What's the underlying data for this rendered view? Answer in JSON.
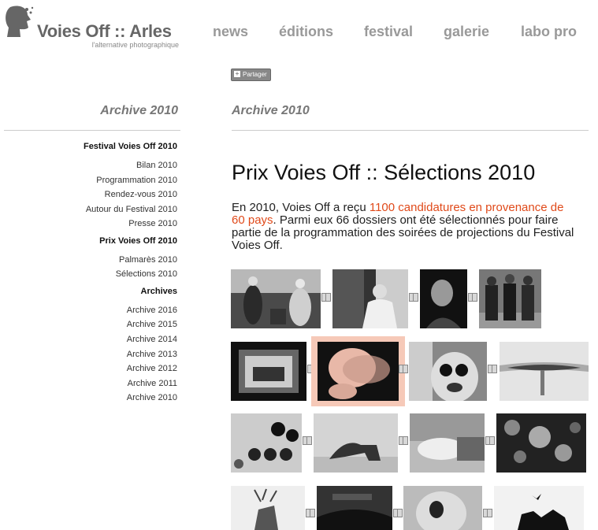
{
  "logo": {
    "title": "Voies Off :: Arles",
    "subtitle": "l'alternative photographique",
    "icon": "head-silhouette-icon"
  },
  "nav": {
    "items": [
      "news",
      "éditions",
      "festival",
      "galerie",
      "labo pro"
    ]
  },
  "share": {
    "label": "Partager",
    "icon": "plus-icon"
  },
  "sidebar": {
    "title": "Archive 2010",
    "items": [
      {
        "label": "Festival Voies Off 2010",
        "head": true
      },
      {
        "label": "Bilan 2010",
        "head": false
      },
      {
        "label": "Programmation 2010",
        "head": false
      },
      {
        "label": "Rendez-vous 2010",
        "head": false
      },
      {
        "label": "Autour du Festival 2010",
        "head": false
      },
      {
        "label": "Presse 2010",
        "head": false
      },
      {
        "label": "Prix Voies Off 2010",
        "head": true
      },
      {
        "label": "Palmarès 2010",
        "head": false
      },
      {
        "label": "Sélections 2010",
        "head": false
      },
      {
        "label": "Archives",
        "head": true
      },
      {
        "label": "Archive 2016",
        "head": false
      },
      {
        "label": "Archive 2015",
        "head": false
      },
      {
        "label": "Archive 2014",
        "head": false
      },
      {
        "label": "Archive 2013",
        "head": false
      },
      {
        "label": "Archive 2012",
        "head": false
      },
      {
        "label": "Archive 2011",
        "head": false
      },
      {
        "label": "Archive 2010",
        "head": false
      }
    ]
  },
  "main": {
    "section_title": "Archive 2010",
    "title": "Prix Voies Off :: Sélections 2010",
    "intro": {
      "line1_a": "En 2010, Voies Off a reçu ",
      "line1_hl": "1100 candidatures en provenance de",
      "line2_hl": "60 pays",
      "line2_b": ". Parmi eux 66 dossiers ont été sélectionnés pour faire",
      "line3": "partie de la programmation des soirées de projections du Festival",
      "line4": "Voies Off."
    }
  },
  "colors": {
    "accent": "#e04a1a",
    "nav": "#999999",
    "highlight_frame": "#f6c9b8"
  },
  "gallery": {
    "thumbs": [
      {
        "name": "thumb-family-portrait",
        "kind": "photo"
      },
      {
        "name": "thumb-man-white-shirt",
        "kind": "photo"
      },
      {
        "name": "thumb-dark-portrait",
        "kind": "photo"
      },
      {
        "name": "thumb-masked-figures",
        "kind": "photo"
      },
      {
        "name": "thumb-framed-car",
        "kind": "photo"
      },
      {
        "name": "thumb-blurred-face",
        "kind": "photo",
        "selected": true
      },
      {
        "name": "thumb-sunglasses-face",
        "kind": "photo"
      },
      {
        "name": "thumb-lips",
        "kind": "photo"
      },
      {
        "name": "thumb-dots",
        "kind": "photo"
      },
      {
        "name": "thumb-figure-floor",
        "kind": "photo"
      },
      {
        "name": "thumb-reclining-body",
        "kind": "photo"
      },
      {
        "name": "thumb-cells",
        "kind": "photo"
      },
      {
        "name": "thumb-deer-statue",
        "kind": "photo"
      },
      {
        "name": "thumb-grass-shadow",
        "kind": "photo"
      },
      {
        "name": "thumb-open-mouth",
        "kind": "photo"
      },
      {
        "name": "thumb-bird-rooftops",
        "kind": "photo"
      }
    ]
  }
}
